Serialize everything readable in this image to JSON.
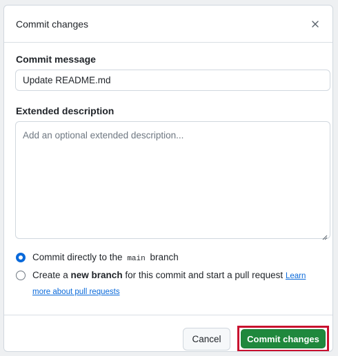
{
  "dialog": {
    "title": "Commit changes",
    "close_icon": "close-icon"
  },
  "form": {
    "message_label": "Commit message",
    "message_value": "Update README.md",
    "description_label": "Extended description",
    "description_placeholder": "Add an optional extended description..."
  },
  "options": {
    "direct": {
      "prefix": "Commit directly to the",
      "branch": "main",
      "suffix": "branch",
      "selected": true
    },
    "new_branch": {
      "prefix": "Create a",
      "bold": "new branch",
      "suffix": "for this commit and start a pull request",
      "link": "Learn more about pull requests",
      "selected": false
    }
  },
  "footer": {
    "cancel_label": "Cancel",
    "commit_label": "Commit changes"
  },
  "colors": {
    "primary_button": "#1f883d",
    "highlight_outline": "#c8102e",
    "radio_selected": "#0969da",
    "link": "#0969da"
  }
}
